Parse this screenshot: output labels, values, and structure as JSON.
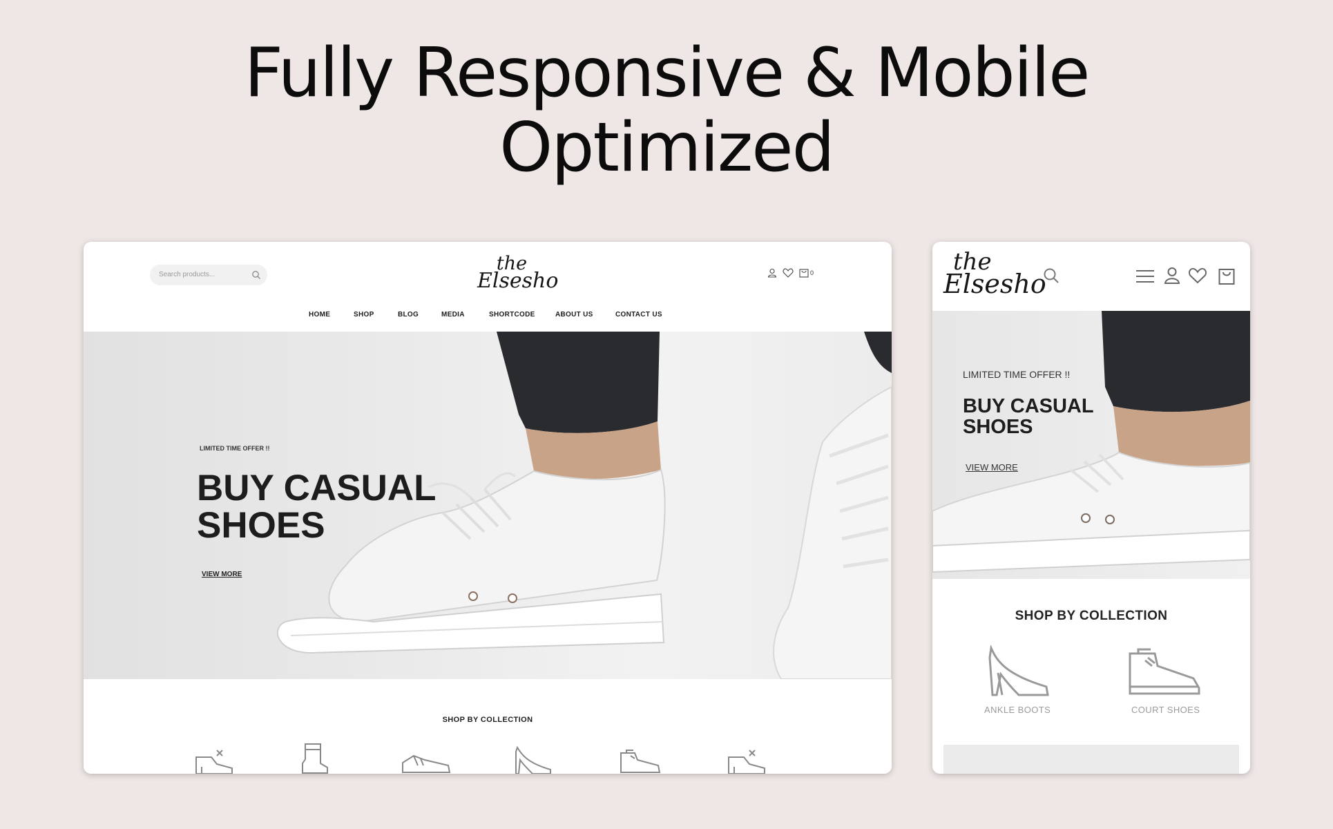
{
  "headline": {
    "line1": "Fully Responsive & Mobile",
    "line2": "Optimized"
  },
  "desktop": {
    "search": {
      "placeholder": "Search products..."
    },
    "logo": {
      "line1": "the",
      "line2": "Elsesho"
    },
    "cart_count": "0",
    "nav": [
      "HOME",
      "SHOP",
      "BLOG",
      "MEDIA",
      "SHORTCODE",
      "ABOUT US",
      "CONTACT US"
    ],
    "hero": {
      "kicker": "LIMITED TIME OFFER !!",
      "title_line1": "BUY CASUAL",
      "title_line2": "SHOES",
      "link": "VIEW MORE"
    },
    "collection_title": "SHOP BY COLLECTION",
    "collection_icons": [
      "heel-boot-icon",
      "ankle-boot-icon",
      "sneaker-icon",
      "high-heel-icon",
      "oxford-shoe-icon",
      "heel-boot-icon"
    ]
  },
  "mobile": {
    "logo": {
      "line1": "the",
      "line2": "Elsesho"
    },
    "hero": {
      "kicker": "LIMITED TIME OFFER !!",
      "title_line1": "BUY CASUAL",
      "title_line2": "SHOES",
      "link": "VIEW MORE"
    },
    "collection_title": "SHOP BY COLLECTION",
    "collections": [
      "ANKLE BOOTS",
      "COURT SHOES"
    ]
  },
  "colors": {
    "background": "#efe7e6",
    "text": "#0c0c0c",
    "hero_bg": "#e9e9e9",
    "pants": "#2a2b2f"
  }
}
